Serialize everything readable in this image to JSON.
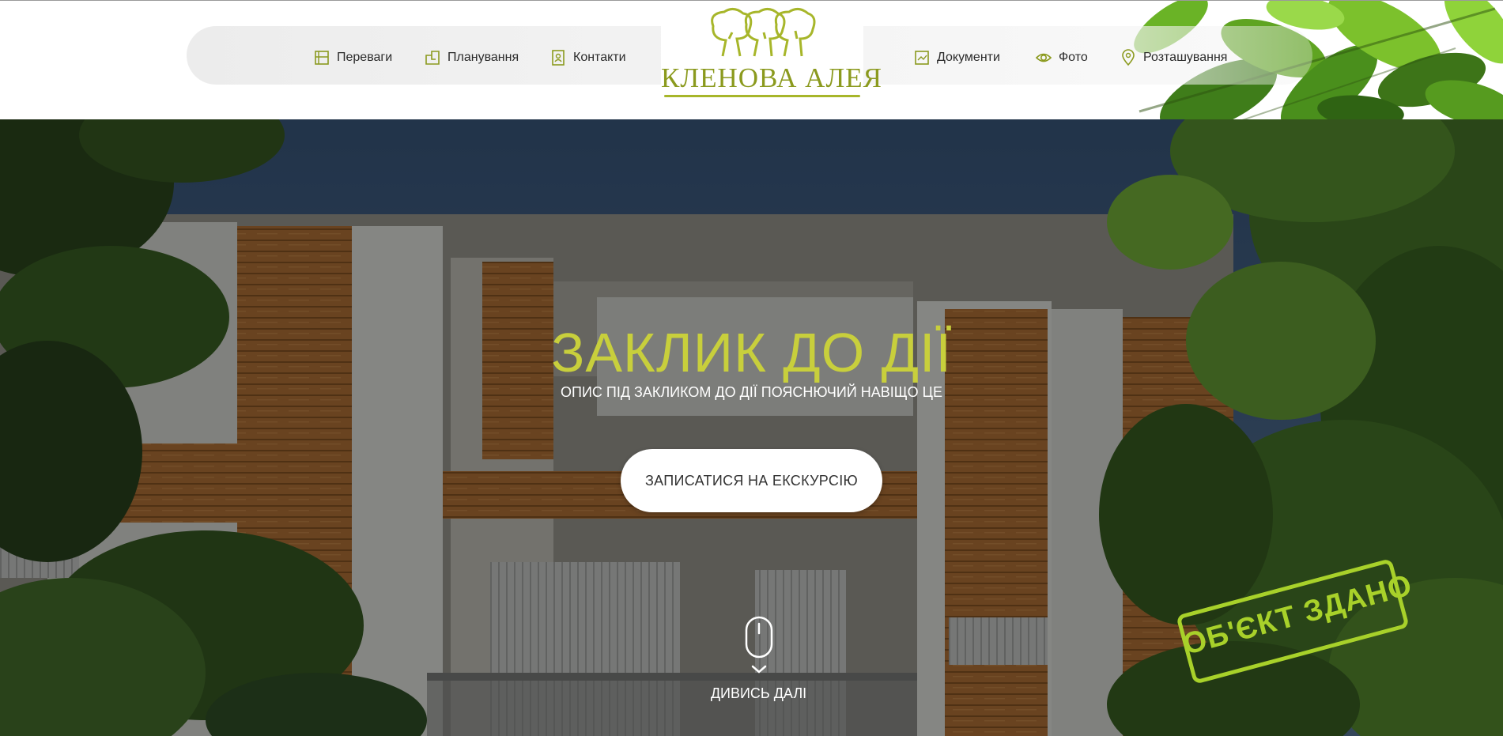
{
  "header": {
    "nav_left": [
      {
        "label": "Переваги",
        "icon": "advantages-icon"
      },
      {
        "label": "Планування",
        "icon": "floorplan-icon"
      },
      {
        "label": "Контакти",
        "icon": "contacts-icon"
      }
    ],
    "nav_right": [
      {
        "label": "Документи",
        "icon": "documents-icon"
      },
      {
        "label": "Фото",
        "icon": "eye-icon"
      },
      {
        "label": "Розташування",
        "icon": "map-pin-icon"
      }
    ],
    "logo_text": "КЛЕНОВА АЛЕЯ"
  },
  "hero": {
    "title": "ЗАКЛИК ДО ДІЇ",
    "subtitle": "ОПИС ПІД ЗАКЛИКОМ ДО ДІЇ ПОЯСНЮЧИЙ НАВІЩО ЦЕ",
    "button_label": "ЗАПИСАТИСЯ НА ЕКСКУРСІЮ",
    "scroll_label": "ДИВИСЬ ДАЛІ",
    "stamp_text": "ОБ'ЄКТ ЗДАНО"
  },
  "colors": {
    "accent_green": "#c8cf3c",
    "logo_green": "#8b9a1e",
    "stamp_green": "#a8d12a"
  }
}
